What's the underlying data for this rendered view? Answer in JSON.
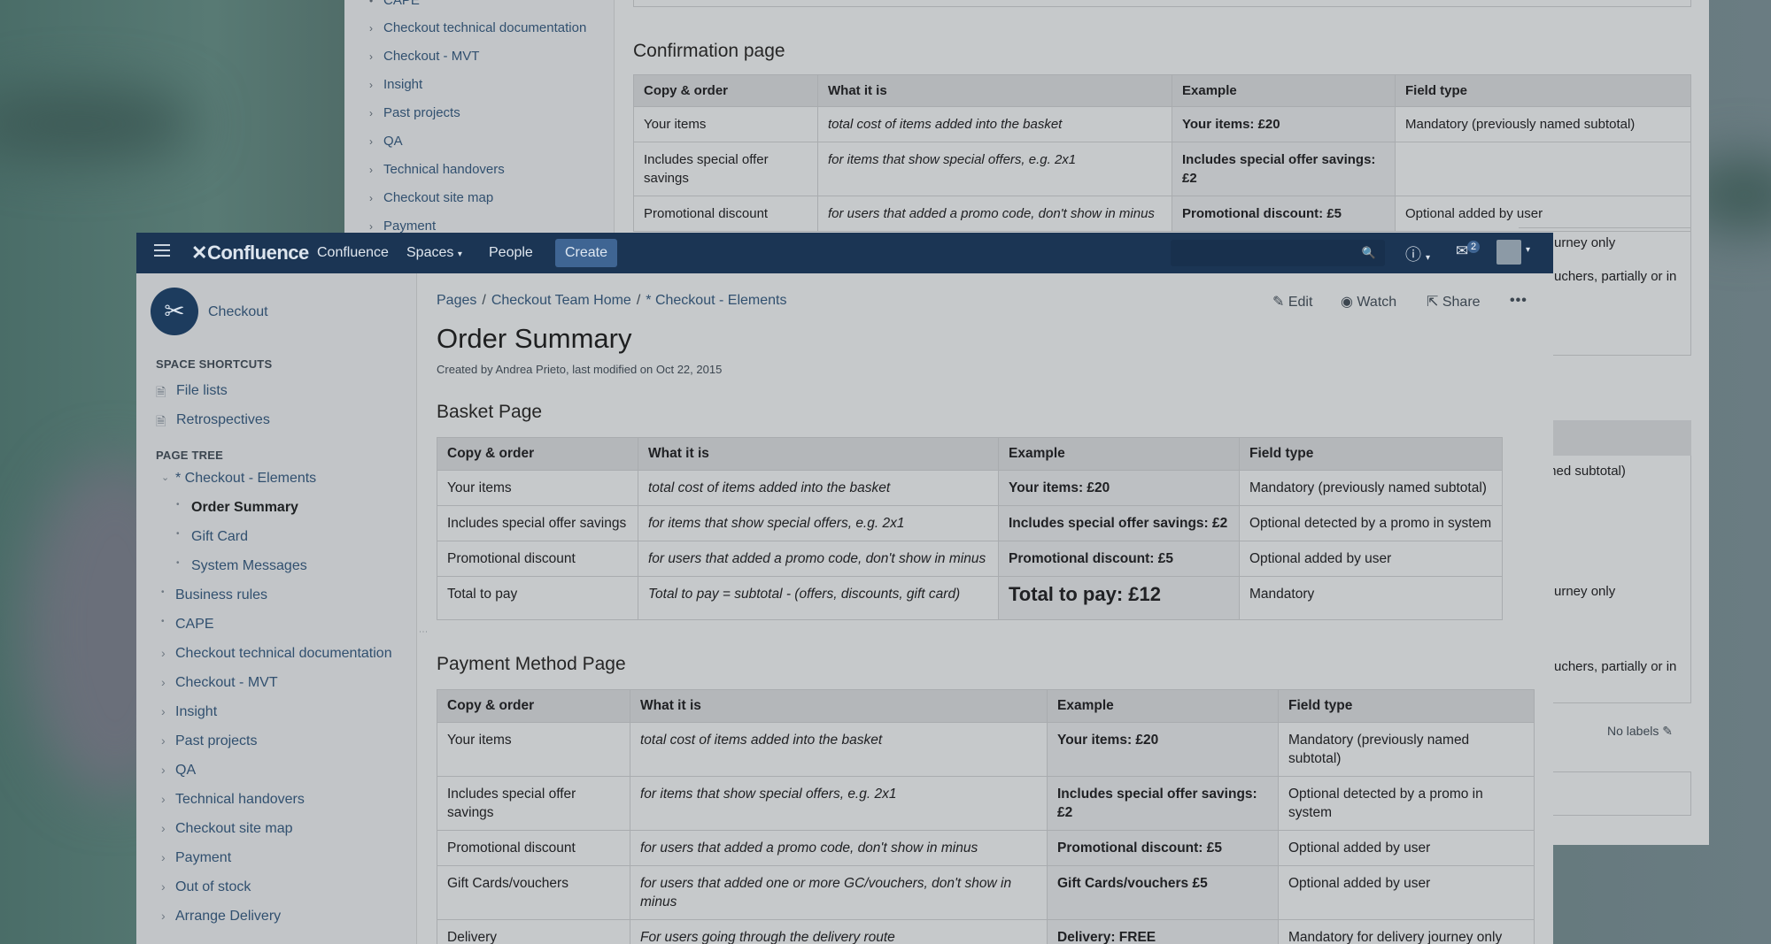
{
  "background_window": {
    "sidebar": {
      "items": [
        {
          "label": "CAPE",
          "has_children": false
        },
        {
          "label": "Checkout technical documentation",
          "has_children": true
        },
        {
          "label": "Checkout - MVT",
          "has_children": true
        },
        {
          "label": "Insight",
          "has_children": true
        },
        {
          "label": "Past projects",
          "has_children": true
        },
        {
          "label": "QA",
          "has_children": true
        },
        {
          "label": "Technical handovers",
          "has_children": true
        },
        {
          "label": "Checkout site map",
          "has_children": true
        },
        {
          "label": "Payment",
          "has_children": true
        }
      ]
    },
    "confirmation": {
      "heading": "Confirmation page",
      "headers": [
        "Copy & order",
        "What it is",
        "Example",
        "Field type"
      ],
      "rows": [
        [
          "Your items",
          "total cost of items added into the basket",
          "Your items: £20",
          "Mandatory (previously named subtotal)"
        ],
        [
          "Includes special offer savings",
          "for items that show special offers, e.g. 2x1",
          "Includes special offer savings: £2",
          ""
        ],
        [
          "Promotional discount",
          "for users that added a promo code, don't show in minus",
          "Promotional discount: £5",
          "Optional added by user"
        ]
      ]
    },
    "peek_texts": {
      "t1": "urney only",
      "t2": "uchers, partially or in",
      "t3": "med subtotal)",
      "t4": "urney only",
      "t5": "uchers, partially or in",
      "no_labels": "No labels"
    }
  },
  "nav": {
    "logo": "Confluence",
    "items": [
      "Confluence",
      "Spaces",
      "People"
    ],
    "create": "Create",
    "notifications_count": "2"
  },
  "space": {
    "name": "Checkout"
  },
  "sidebar": {
    "shortcuts_heading": "SPACE SHORTCUTS",
    "shortcuts": [
      "File lists",
      "Retrospectives"
    ],
    "tree_heading": "PAGE TREE",
    "tree": {
      "parent": "* Checkout - Elements",
      "children": [
        "Order Summary",
        "Gift Card",
        "System Messages"
      ],
      "others_bullet": [
        "Business rules",
        "CAPE"
      ],
      "others": [
        "Checkout technical documentation",
        "Checkout - MVT",
        "Insight",
        "Past projects",
        "QA",
        "Technical handovers",
        "Checkout site map",
        "Payment",
        "Out of stock",
        "Arrange Delivery"
      ]
    }
  },
  "page": {
    "breadcrumb": [
      "Pages",
      "Checkout Team Home",
      "* Checkout - Elements"
    ],
    "actions": {
      "edit": "Edit",
      "watch": "Watch",
      "share": "Share"
    },
    "title": "Order Summary",
    "meta": "Created by Andrea Prieto, last modified on Oct 22, 2015",
    "basket": {
      "heading": "Basket Page",
      "headers": [
        "Copy & order",
        "What it is",
        "Example",
        "Field type"
      ],
      "rows": [
        [
          "Your items",
          "total cost of items added into the basket",
          "Your items: £20",
          "Mandatory (previously named subtotal)"
        ],
        [
          "Includes special offer savings",
          "for items that show special offers, e.g. 2x1",
          "Includes special offer savings: £2",
          "Optional detected by a promo in system"
        ],
        [
          "Promotional discount",
          "for users that added a promo code, don't show in minus",
          "Promotional discount: £5",
          "Optional added by user"
        ],
        [
          "Total to pay",
          "Total to pay =  subtotal - (offers, discounts, gift card)",
          "Total to pay: £12",
          "Mandatory"
        ]
      ]
    },
    "payment": {
      "heading": "Payment Method Page",
      "headers": [
        "Copy & order",
        "What it is",
        "Example",
        "Field type"
      ],
      "rows": [
        [
          "Your items",
          "total cost of items added into the basket",
          "Your items: £20",
          "Mandatory (previously named subtotal)"
        ],
        [
          "Includes special offer savings",
          "for items that show special offers, e.g. 2x1",
          "Includes special offer savings: £2",
          "Optional detected by a promo in system"
        ],
        [
          "Promotional discount",
          "for users that added a promo code, don't show in minus",
          "Promotional discount: £5",
          "Optional added by user"
        ],
        [
          "Gift Cards/vouchers",
          "for users that added one or more GC/vouchers, don't show in minus",
          "Gift Cards/vouchers £5",
          "Optional added by user"
        ],
        [
          "Delivery",
          "For users going through the delivery route",
          "Delivery: FREE",
          "Mandatory for delivery journey only"
        ]
      ]
    }
  }
}
